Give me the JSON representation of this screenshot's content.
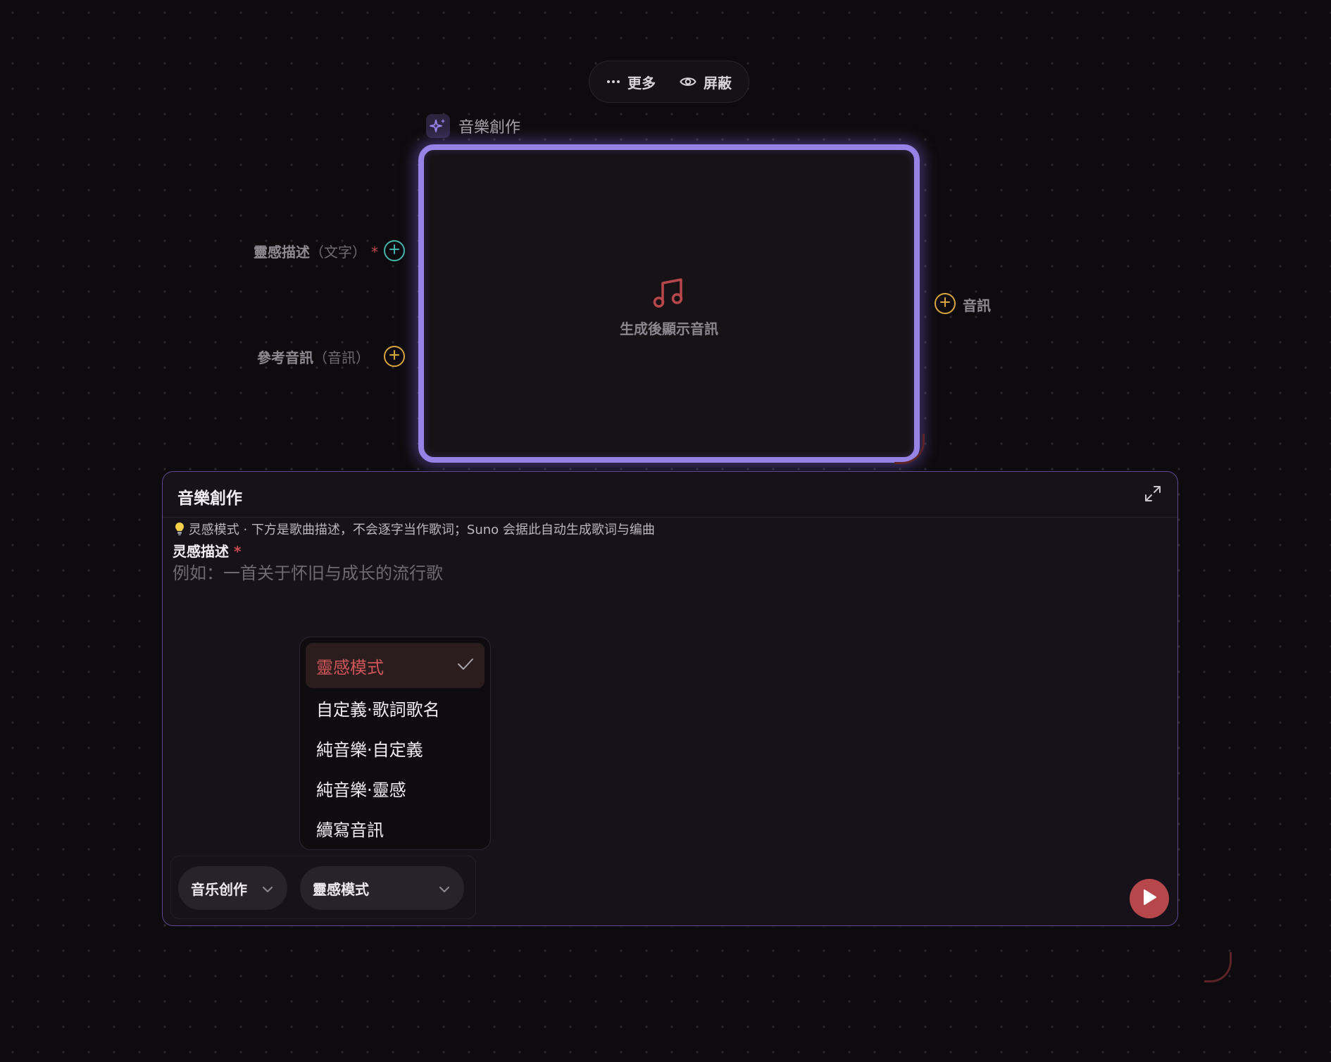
{
  "toolbar": {
    "more_label": "更多",
    "hide_label": "屏蔽",
    "more_icon": "more-dots-icon",
    "hide_icon": "eye-icon"
  },
  "node": {
    "title": "音樂創作",
    "icon": "sparkle-icon",
    "empty_icon": "music-note-icon",
    "empty_text": "生成後顯示音訊"
  },
  "inputs": [
    {
      "label": "靈感描述",
      "type": "（文字）",
      "required_mark": "*",
      "color": "#45b3ad"
    },
    {
      "label": "參考音訊",
      "type": "（音訊）",
      "color": "#d9a441"
    }
  ],
  "output": {
    "label": "音訊",
    "color": "#d9a441"
  },
  "panel": {
    "title": "音樂創作",
    "hint_icon": "lightbulb-icon",
    "hint": "灵感模式 · 下方是歌曲描述，不会逐字当作歌词；Suno 会据此自动生成歌词与编曲",
    "field_label": "灵感描述",
    "required_mark": "*",
    "placeholder": "例如：一首关于怀旧与成长的流行歌",
    "value": ""
  },
  "mode_menu": {
    "items": [
      {
        "label": "靈感模式",
        "selected": true
      },
      {
        "label": "自定義·歌詞歌名",
        "selected": false
      },
      {
        "label": "純音樂·自定義",
        "selected": false
      },
      {
        "label": "純音樂·靈感",
        "selected": false
      },
      {
        "label": "續寫音訊",
        "selected": false
      }
    ]
  },
  "selectors": {
    "category": "音乐创作",
    "mode": "靈感模式"
  },
  "colors": {
    "accent_purple": "#9782e6",
    "accent_red": "#b8474c",
    "background": "#0d0b0d"
  }
}
